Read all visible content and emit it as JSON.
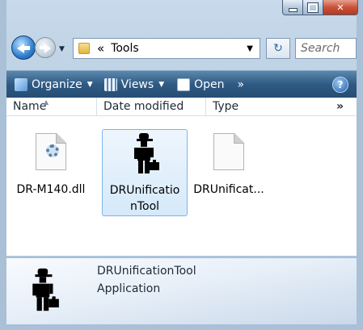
{
  "window": {
    "caption_buttons": [
      "minimize",
      "maximize",
      "close"
    ]
  },
  "navigation": {
    "breadcrumb_chevron": "«",
    "address_path": "Tools",
    "search_placeholder": "Search"
  },
  "toolbar": {
    "organize_label": "Organize",
    "views_label": "Views",
    "open_label": "Open",
    "more_label": "»",
    "help_label": "?"
  },
  "columns": {
    "name": "Name",
    "date_modified": "Date modified",
    "type": "Type",
    "more": "»"
  },
  "files": [
    {
      "name": "DR-M140.dll",
      "icon": "dll-file-icon",
      "selected": false
    },
    {
      "name": "DRUnificatio nTool",
      "icon": "app-person-icon",
      "selected": true
    },
    {
      "name": "DRUnificat...",
      "icon": "blank-file-icon",
      "selected": false
    }
  ],
  "details": {
    "name": "DRUnificationTool",
    "type": "Application",
    "icon": "app-person-icon"
  },
  "colors": {
    "toolbar": "#2e5a84",
    "selection": "#d5e9fa",
    "close_button": "#c9523a"
  }
}
